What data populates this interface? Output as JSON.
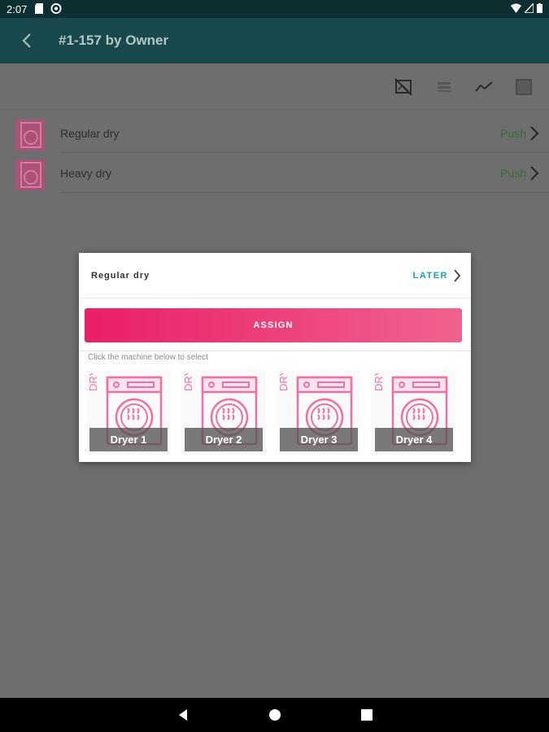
{
  "status_bar": {
    "time": "2:07"
  },
  "app_bar": {
    "title": "#1-157 by Owner"
  },
  "list": {
    "items": [
      {
        "label": "Regular dry",
        "action": "Push"
      },
      {
        "label": "Heavy dry",
        "action": "Push"
      }
    ]
  },
  "dialog": {
    "title": "Regular dry",
    "later_label": "LATER",
    "assign_label": "ASSIGN",
    "hint": "Click the machine below to select",
    "machine_tag": "DRY",
    "machines": [
      {
        "name": "Dryer 1"
      },
      {
        "name": "Dryer 2"
      },
      {
        "name": "Dryer 3"
      },
      {
        "name": "Dryer 4"
      }
    ]
  },
  "colors": {
    "accent_pink": "#ea1e69",
    "teal": "#1aa1a8",
    "app_bar": "#17484b",
    "status_bar": "#0d2f31"
  }
}
